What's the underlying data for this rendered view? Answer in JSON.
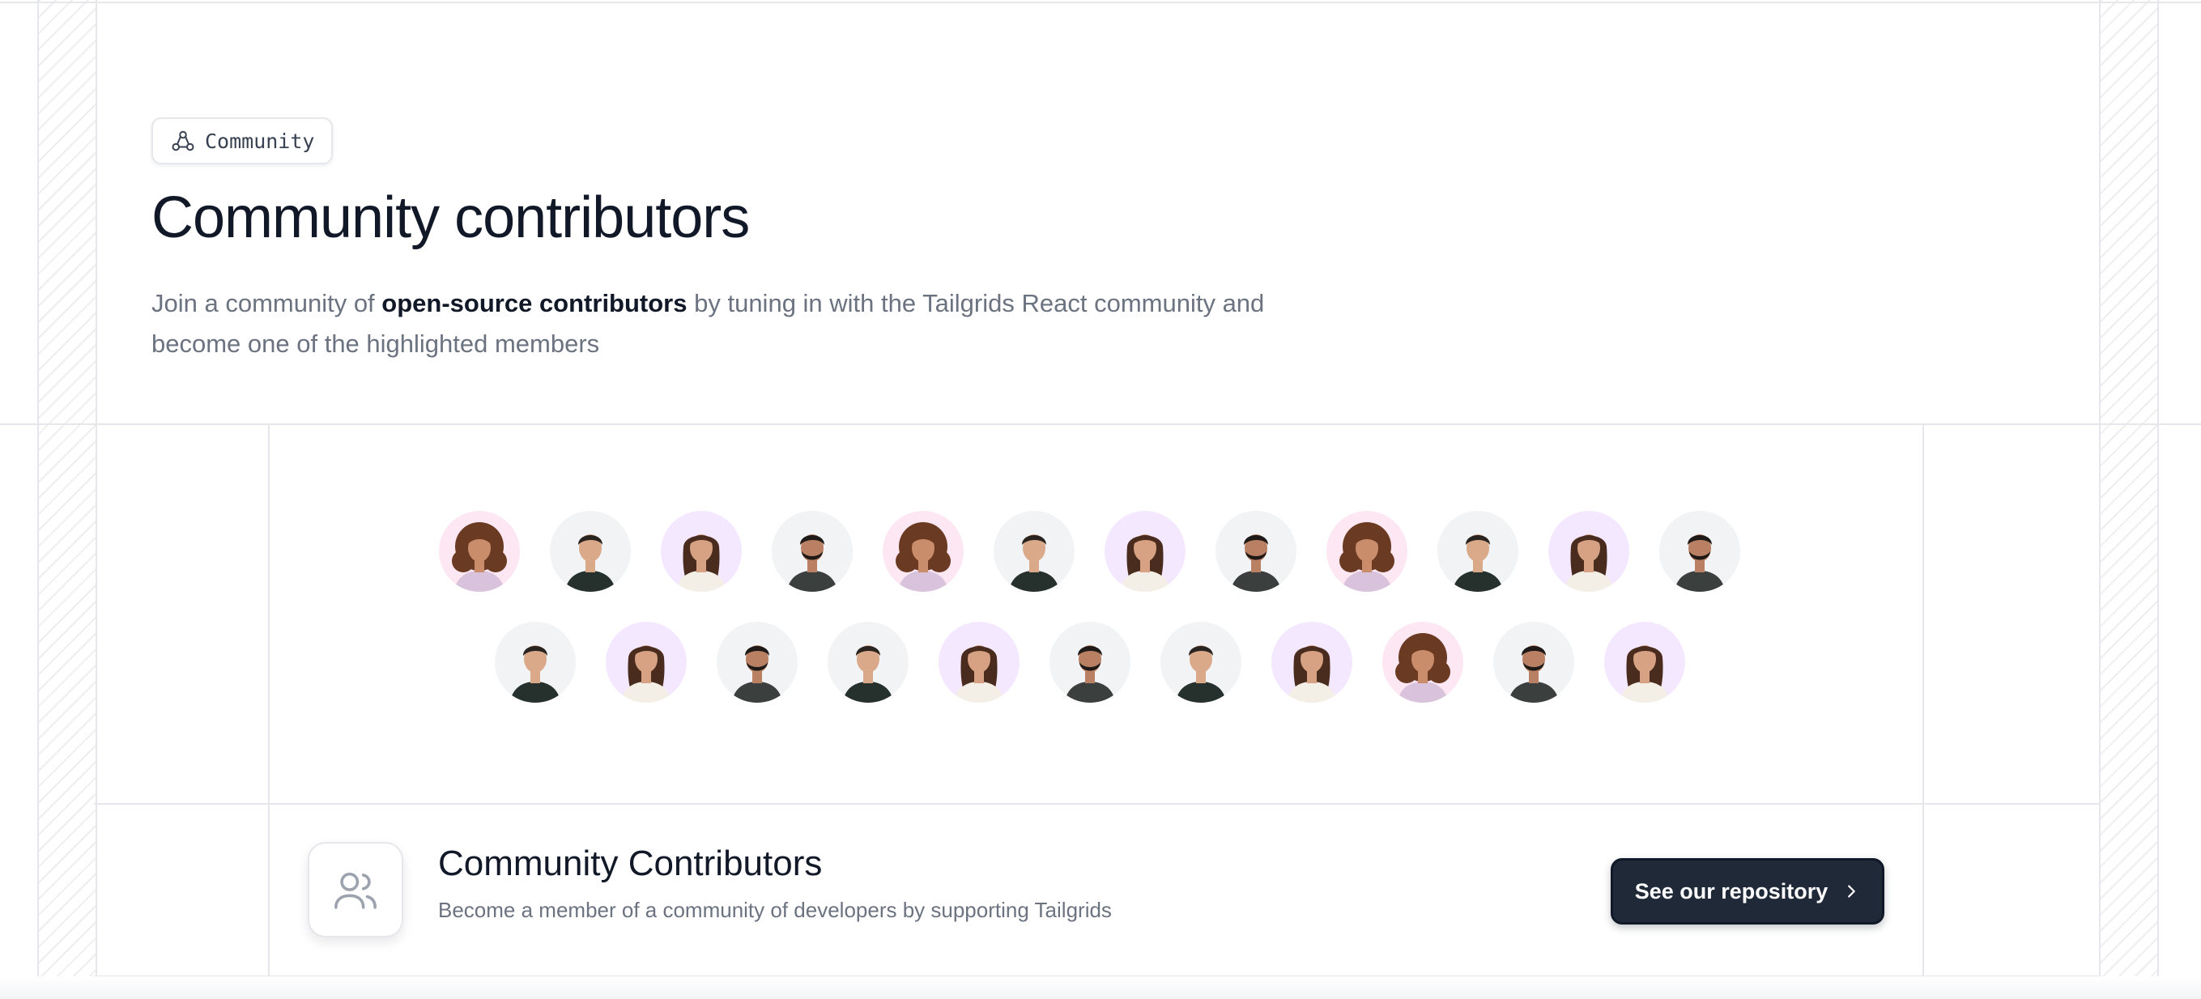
{
  "badge": {
    "label": "Community",
    "icon": "community-icon"
  },
  "heading": {
    "title": "Community contributors"
  },
  "description": {
    "prefix": "Join a community of ",
    "highlight": "open-source contributors",
    "suffix": " by tuning in with the Tailgrids React community and become one of the highlighted members"
  },
  "avatars": {
    "row1": [
      "curly-woman",
      "man-short-hair",
      "woman-long-hair",
      "man-beard",
      "curly-woman",
      "man-short-hair",
      "woman-long-hair",
      "man-beard",
      "curly-woman",
      "man-short-hair",
      "woman-long-hair",
      "man-beard"
    ],
    "row2": [
      "man-short-hair",
      "woman-long-hair",
      "man-beard",
      "man-short-hair",
      "woman-long-hair",
      "man-beard",
      "man-short-hair",
      "woman-long-hair",
      "curly-woman",
      "man-beard",
      "woman-long-hair"
    ]
  },
  "cta": {
    "icon": "users-icon",
    "title": "Community Contributors",
    "subtitle": "Become a member of a community of developers by supporting Tailgrids",
    "button_label": "See our repository",
    "button_icon": "chevron-right-icon"
  },
  "colors": {
    "text_primary": "#111827",
    "text_muted": "#6b7280",
    "button_bg": "#1f2937",
    "border": "#e5e7eb",
    "avatar_pink_bg": "#fce7f3",
    "avatar_gray_bg": "#f1f3f5",
    "avatar_lavender_bg": "#f3e8ff"
  }
}
